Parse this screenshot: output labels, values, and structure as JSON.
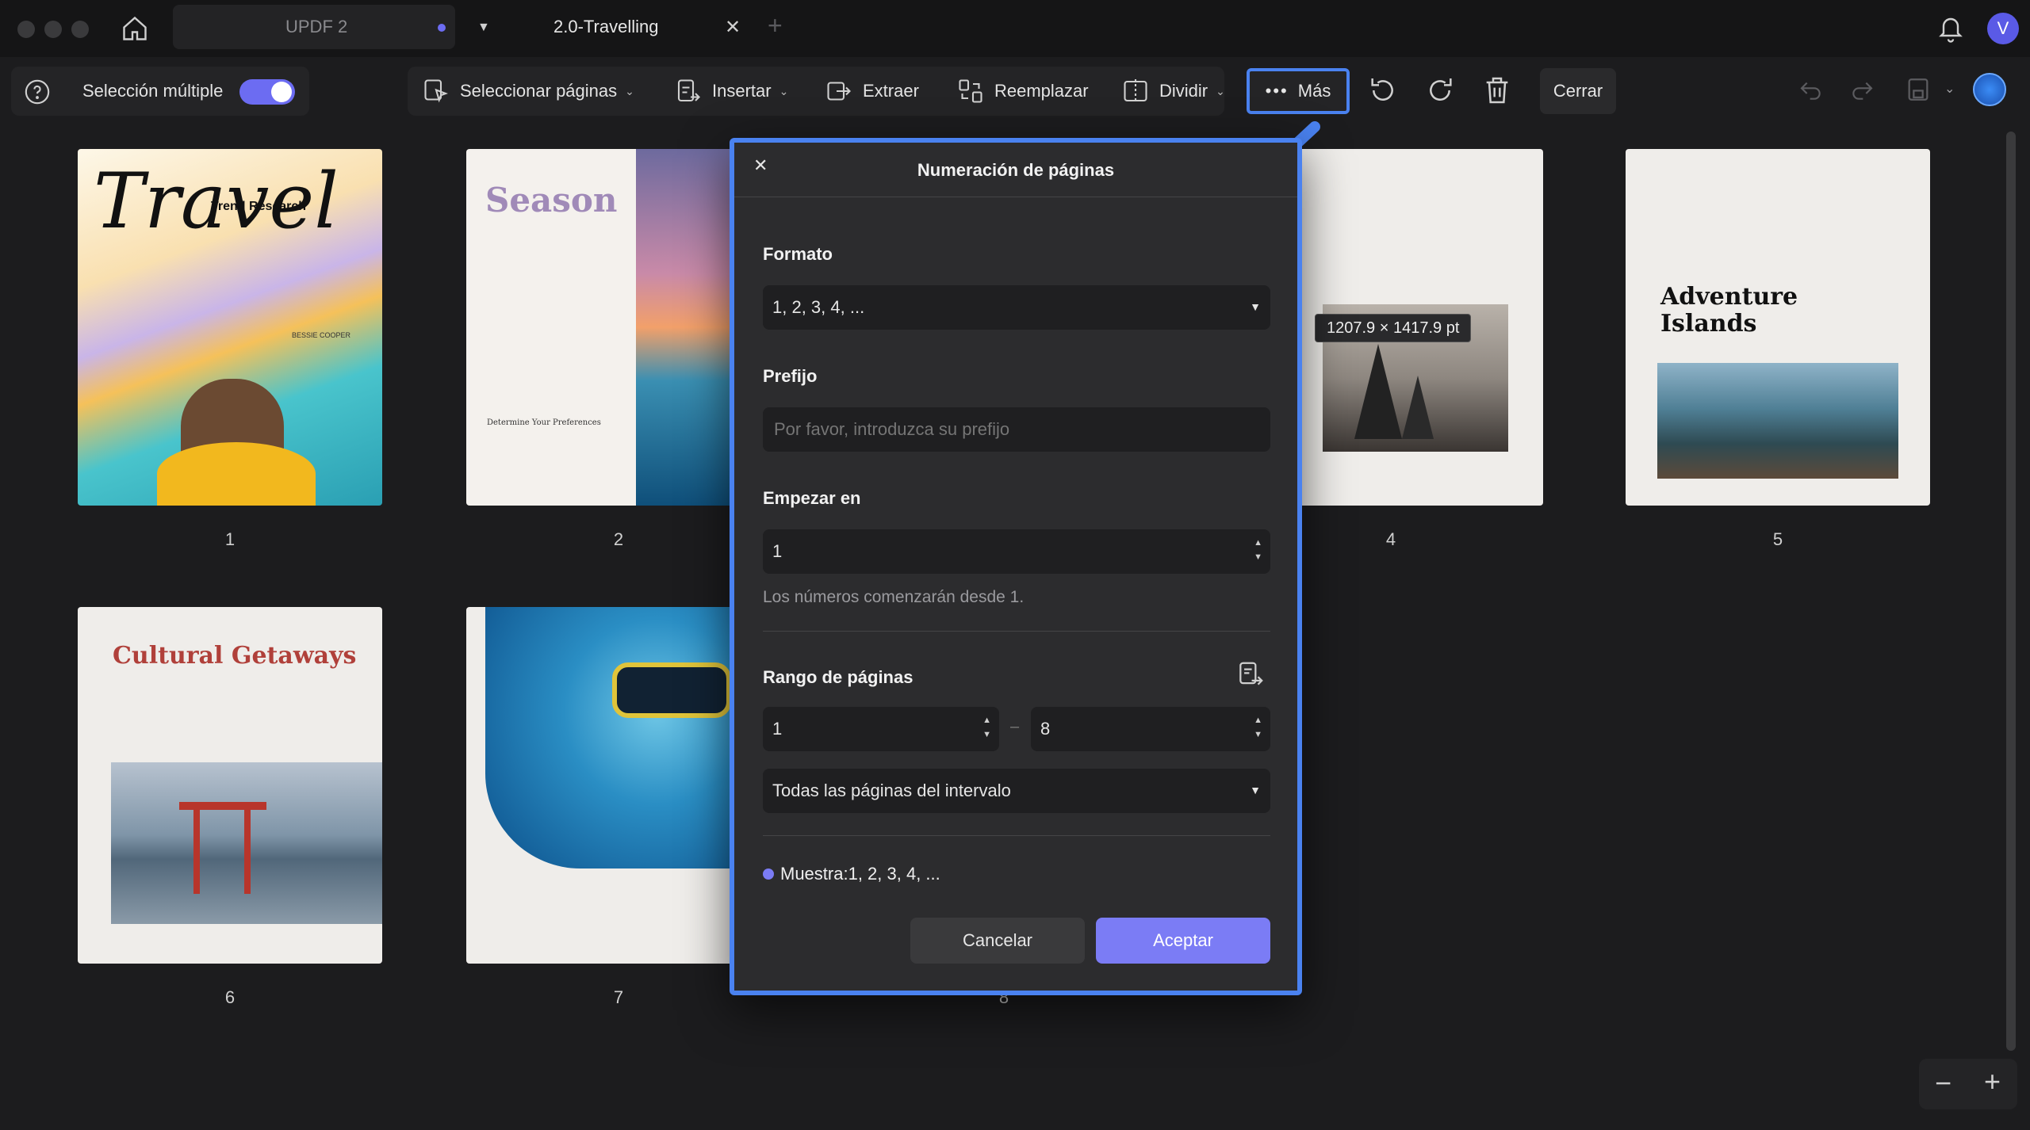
{
  "titlebar": {
    "tabs": [
      {
        "label": "UPDF 2"
      },
      {
        "label": "2.0-Travelling"
      }
    ],
    "avatar_letter": "V"
  },
  "toolbar": {
    "multi_select_label": "Selección múltiple",
    "select_pages_label": "Seleccionar páginas",
    "insert_label": "Insertar",
    "extract_label": "Extraer",
    "replace_label": "Reemplazar",
    "split_label": "Dividir",
    "more_label": "Más",
    "close_label": "Cerrar"
  },
  "pages": [
    {
      "number": "1",
      "title": "Travel",
      "subtitle": "Trend Research",
      "author": "BESSIE COOPER"
    },
    {
      "number": "2",
      "title": "Season",
      "subheading": "Determine Your Preferences"
    },
    {
      "number": "4"
    },
    {
      "number": "5",
      "title": "Adventure Islands"
    },
    {
      "number": "6",
      "title": "Cultural Getaways"
    },
    {
      "number": "7"
    },
    {
      "number": "8"
    }
  ],
  "tooltip": {
    "size_text": "1207.9 × 1417.9 pt"
  },
  "dialog": {
    "title": "Numeración de páginas",
    "format_label": "Formato",
    "format_value": "1, 2, 3, 4, ...",
    "prefix_label": "Prefijo",
    "prefix_placeholder": "Por favor, introduzca su prefijo",
    "start_label": "Empezar en",
    "start_value": "1",
    "start_hint": "Los números comenzarán desde 1.",
    "range_label": "Rango de páginas",
    "range_from": "1",
    "range_to": "8",
    "range_mode": "Todas las páginas del intervalo",
    "sample_text": "Muestra:1, 2, 3, 4, ...",
    "cancel_label": "Cancelar",
    "accept_label": "Aceptar"
  },
  "colors": {
    "accent": "#4a82f0",
    "accept_button": "#7b7cf5",
    "toggle": "#6c6cf2"
  }
}
